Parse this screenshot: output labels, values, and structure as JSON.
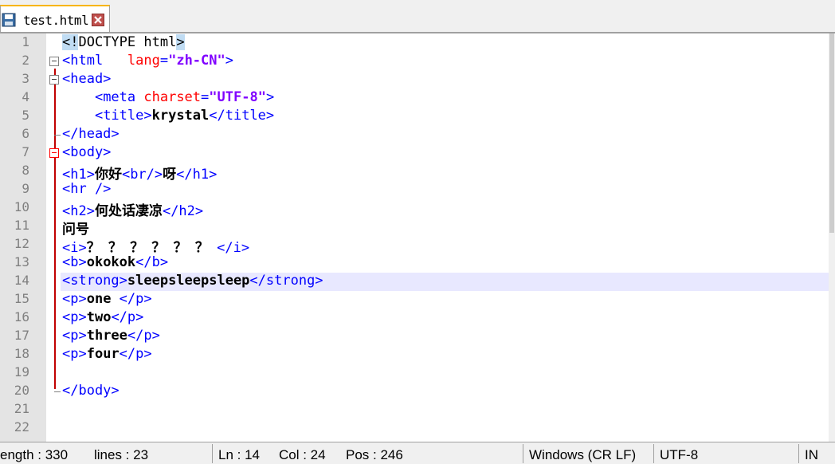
{
  "tab": {
    "label": "test.html"
  },
  "editor": {
    "line_numbers": [
      "1",
      "2",
      "3",
      "4",
      "5",
      "6",
      "7",
      "8",
      "9",
      "10",
      "11",
      "12",
      "13",
      "14",
      "15",
      "16",
      "17",
      "18",
      "19",
      "20",
      "21",
      "22"
    ],
    "lines": [
      {
        "parts": [
          [
            "doc-hl",
            "<!"
          ],
          [
            "doc",
            "DOCTYPE html"
          ],
          [
            "doc-hl",
            ">"
          ]
        ]
      },
      {
        "parts": [
          [
            "tag",
            "<html   "
          ],
          [
            "attr",
            "lang"
          ],
          [
            "tag",
            "="
          ],
          [
            "val",
            "\"zh-CN\""
          ],
          [
            "tag",
            ">"
          ]
        ]
      },
      {
        "parts": [
          [
            "tag",
            "<head>"
          ]
        ]
      },
      {
        "parts": [
          [
            "doc",
            "    "
          ],
          [
            "tag",
            "<meta "
          ],
          [
            "attr",
            "charset"
          ],
          [
            "tag",
            "="
          ],
          [
            "val",
            "\"UTF-8\""
          ],
          [
            "tag",
            ">"
          ]
        ]
      },
      {
        "parts": [
          [
            "doc",
            "    "
          ],
          [
            "tag",
            "<title>"
          ],
          [
            "txt",
            "krystal"
          ],
          [
            "tag",
            "</title>"
          ]
        ]
      },
      {
        "parts": [
          [
            "tag",
            "</head>"
          ]
        ]
      },
      {
        "parts": [
          [
            "tag",
            "<body>"
          ]
        ]
      },
      {
        "parts": [
          [
            "tag",
            "<h1>"
          ],
          [
            "txt",
            "你好"
          ],
          [
            "tag",
            "<br/>"
          ],
          [
            "txt",
            "呀"
          ],
          [
            "tag",
            "</h1>"
          ]
        ]
      },
      {
        "parts": [
          [
            "tag",
            "<hr />"
          ]
        ]
      },
      {
        "parts": [
          [
            "tag",
            "<h2>"
          ],
          [
            "txt",
            "何处话凄凉"
          ],
          [
            "tag",
            "</h2>"
          ]
        ]
      },
      {
        "parts": [
          [
            "txt",
            "问号"
          ]
        ]
      },
      {
        "parts": [
          [
            "tag",
            "<i>"
          ],
          [
            "txt",
            "？ ？ ？ ？ ？ ？ "
          ],
          [
            "tag",
            "</i>"
          ]
        ]
      },
      {
        "parts": [
          [
            "tag",
            "<b>"
          ],
          [
            "txt",
            "okokok"
          ],
          [
            "tag",
            "</b>"
          ]
        ]
      },
      {
        "parts": [
          [
            "tag",
            "<strong>"
          ],
          [
            "txt",
            "sleepsleepsleep"
          ],
          [
            "tag",
            "</strong>"
          ]
        ]
      },
      {
        "parts": [
          [
            "tag",
            "<p>"
          ],
          [
            "txt",
            "one "
          ],
          [
            "tag",
            "</p>"
          ]
        ]
      },
      {
        "parts": [
          [
            "tag",
            "<p>"
          ],
          [
            "txt",
            "two"
          ],
          [
            "tag",
            "</p>"
          ]
        ]
      },
      {
        "parts": [
          [
            "tag",
            "<p>"
          ],
          [
            "txt",
            "three"
          ],
          [
            "tag",
            "</p>"
          ]
        ]
      },
      {
        "parts": [
          [
            "tag",
            "<p>"
          ],
          [
            "txt",
            "four"
          ],
          [
            "tag",
            "</p>"
          ]
        ]
      },
      {
        "parts": []
      },
      {
        "parts": [
          [
            "tag",
            "</body>"
          ]
        ]
      },
      {
        "parts": []
      },
      {
        "parts": []
      }
    ]
  },
  "status": {
    "length": "ength : 330",
    "lines": "lines : 23",
    "ln": "Ln : 14",
    "col": "Col : 24",
    "pos": "Pos : 246",
    "eol": "Windows (CR LF)",
    "encoding": "UTF-8",
    "mode": "IN"
  },
  "colors": {
    "tag": "#0000ff",
    "attr": "#ff0000",
    "value": "#8000ff",
    "current_line": "#e8e8ff"
  }
}
